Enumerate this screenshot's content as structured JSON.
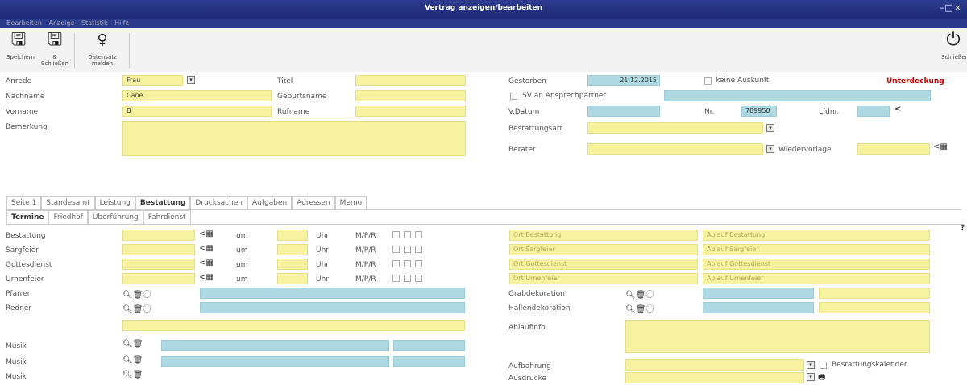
{
  "window": {
    "title": "Vertrag anzeigen/bearbeiten",
    "controls": "–□×"
  },
  "menu": [
    "Bearbeiten",
    "Anzeige",
    "Statistik",
    "Hilfe"
  ],
  "toolbar": {
    "save": "Speichern",
    "save_close": "& Schließen",
    "data_report": "Datensatz melden",
    "close": "Schließen"
  },
  "form": {
    "anrede_label": "Anrede",
    "anrede_value": "Frau",
    "titel_label": "Titel",
    "nachname_label": "Nachname",
    "nachname_value": "Cane",
    "geburtsname_label": "Geburtsname",
    "vorname_label": "Vorname",
    "vorname_value": "B",
    "rufname_label": "Rufname",
    "bemerkung_label": "Bemerkung",
    "gestorben_label": "Gestorben",
    "gestorben_value": "21.12.2015",
    "keine_auskunft_label": "keine Auskunft",
    "unterdeckung": "Unterdeckung",
    "sv_label": "SV an Ansprechpartner",
    "vdatum_label": "V.Datum",
    "nr_label": "Nr.",
    "nr_value": "789950",
    "lfdnr_label": "Lfdnr.",
    "bestattungsart_label": "Bestattungsart",
    "berater_label": "Berater",
    "wiedervorlage_label": "Wiedervorlage"
  },
  "tabs": [
    "Seite 1",
    "Standesamt",
    "Leistung",
    "Bestattung",
    "Drucksachen",
    "Aufgaben",
    "Adressen",
    "Memo"
  ],
  "subtabs": [
    "Termine",
    "Friedhof",
    "Überführung",
    "Fahrdienst"
  ],
  "termine": {
    "um": "um",
    "uhr": "Uhr",
    "mpr": "M/P/R",
    "rows": [
      "Bestattung",
      "Sargfeier",
      "Gottesdienst",
      "Urnenfeier"
    ]
  },
  "ort": [
    {
      "ort": "Ort Bestattung",
      "ablauf": "Ablauf Bestattung"
    },
    {
      "ort": "Ort Sargfeier",
      "ablauf": "Ablauf Sargfeier"
    },
    {
      "ort": "Ort Gottesdienst",
      "ablauf": "Ablauf Gottesdienst"
    },
    {
      "ort": "Ort Urnenfeier",
      "ablauf": "Ablauf Urnenfeier"
    }
  ],
  "left_lower": {
    "pfarrer": "Pfarrer",
    "redner": "Redner",
    "musik": "Musik"
  },
  "right_lower": {
    "grabdekoration": "Grabdekoration",
    "hallendekoration": "Hallendekoration",
    "ablaufinfo": "Ablaufinfo",
    "aufbahrung": "Aufbahrung",
    "bestattungskalender": "Bestattungskalender",
    "ausdrucke": "Ausdrucke"
  },
  "help": "?",
  "colors": {
    "titlebar": "#1e2a74",
    "yellow_field": "#f7f2a0",
    "blue_field": "#aed9e3",
    "alert": "#cc0000"
  }
}
